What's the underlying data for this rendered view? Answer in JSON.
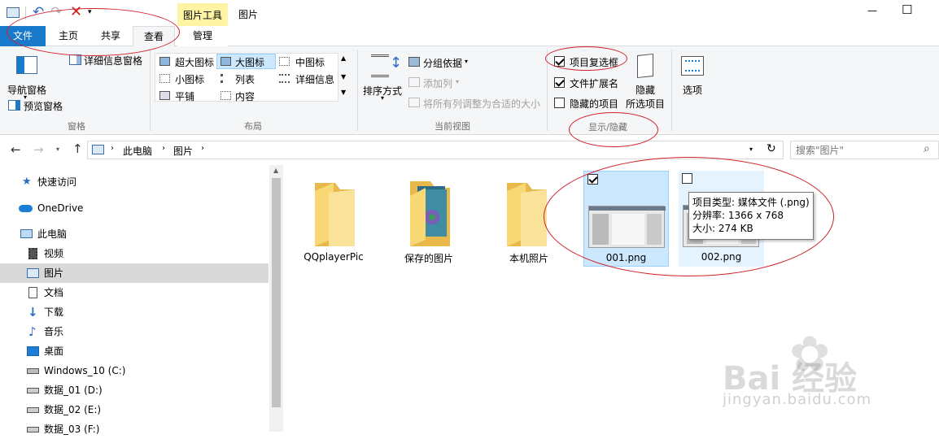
{
  "window": {
    "context_tab_group": "图片工具",
    "title": "图片",
    "minimize": "—",
    "maximize": "☐"
  },
  "tabs": {
    "file": "文件",
    "home": "主页",
    "share": "共享",
    "view": "查看",
    "manage": "管理"
  },
  "ribbon": {
    "panes": {
      "nav_pane": "导航窗格",
      "preview_pane": "预览窗格",
      "details_pane": "详细信息窗格",
      "label": "窗格"
    },
    "layout": {
      "extra_large": "超大图标",
      "large": "大图标",
      "medium": "中图标",
      "small": "小图标",
      "list": "列表",
      "details": "详细信息",
      "tiles": "平铺",
      "content": "内容",
      "label": "布局"
    },
    "current_view": {
      "sort_by": "排序方式",
      "group_by": "分组依据",
      "add_columns": "添加列",
      "size_all_columns": "将所有列调整为合适的大小",
      "label": "当前视图"
    },
    "show_hide": {
      "item_checkboxes": "项目复选框",
      "file_extensions": "文件扩展名",
      "hidden_items": "隐藏的项目",
      "hide_selected_1": "隐藏",
      "hide_selected_2": "所选项目",
      "label": "显示/隐藏"
    },
    "options": "选项"
  },
  "address": {
    "crumb1": "此电脑",
    "crumb2": "图片",
    "search_placeholder": "搜索\"图片\""
  },
  "nav": {
    "quick_access": "快速访问",
    "onedrive": "OneDrive",
    "this_pc": "此电脑",
    "videos": "视频",
    "pictures": "图片",
    "documents": "文档",
    "downloads": "下载",
    "music": "音乐",
    "desktop": "桌面",
    "drive_c": "Windows_10 (C:)",
    "drive_d": "数据_01 (D:)",
    "drive_e": "数据_02 (E:)",
    "drive_f": "数据_03 (F:)"
  },
  "items": {
    "qqplayer": "QQplayerPic",
    "saved": "保存的图片",
    "camera_roll": "本机照片",
    "file1": "001.png",
    "file2": "002.png"
  },
  "tooltip": {
    "type": "项目类型: 媒体文件 (.png)",
    "resolution": "分辨率: 1366 x 768",
    "size": "大小: 274 KB"
  },
  "watermark": {
    "brand": "Bai  经验",
    "url": "jingyan.baidu.com"
  },
  "colors": {
    "accent": "#1979ca",
    "context_tab": "#fff4a3",
    "selection": "#cce8ff",
    "hover": "#e5f3ff",
    "annotation": "#d0202a",
    "folder": "#f8d775"
  }
}
